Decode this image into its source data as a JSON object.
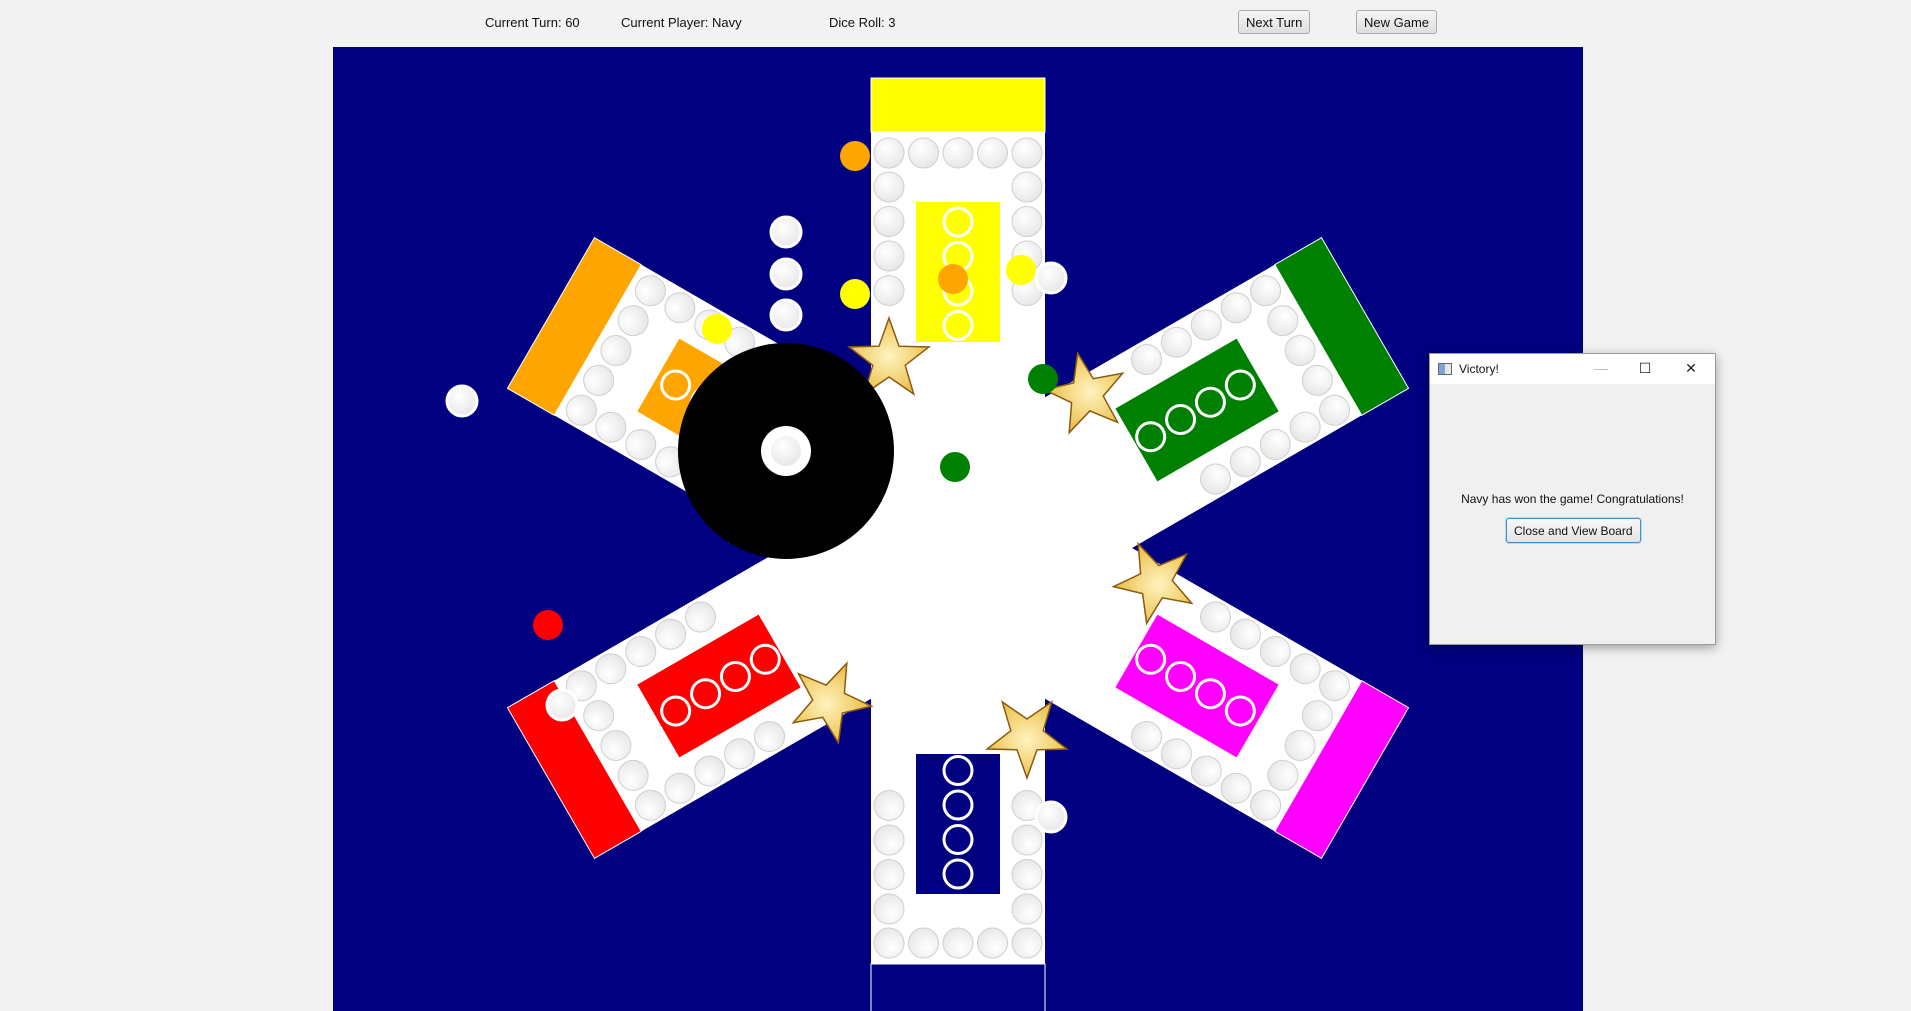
{
  "status": {
    "turn_text": "Current Turn: 60",
    "player_text": "Current Player: Navy",
    "dice_text": "Dice Roll: 3"
  },
  "toolbar": {
    "next_turn_label": "Next Turn",
    "new_game_label": "New Game"
  },
  "board": {
    "background_color": "#000080",
    "center_color": "#000000",
    "players": [
      {
        "name": "Yellow",
        "color": "#ffff00"
      },
      {
        "name": "Green",
        "color": "#008000"
      },
      {
        "name": "Magenta",
        "color": "#ff00ff"
      },
      {
        "name": "Navy",
        "color": "#000080"
      },
      {
        "name": "Red",
        "color": "#ff0000"
      },
      {
        "name": "Orange",
        "color": "#ffa500"
      }
    ],
    "empty_spot_color": "#e6e6e6",
    "star_color": "#e8b93a"
  },
  "dialog": {
    "title": "Victory!",
    "message": "Navy has won the game! Congratulations!",
    "button_label": "Close and View Board",
    "minimize_icon": "minimize-icon",
    "maximize_icon": "maximize-icon",
    "close_icon": "close-icon"
  }
}
